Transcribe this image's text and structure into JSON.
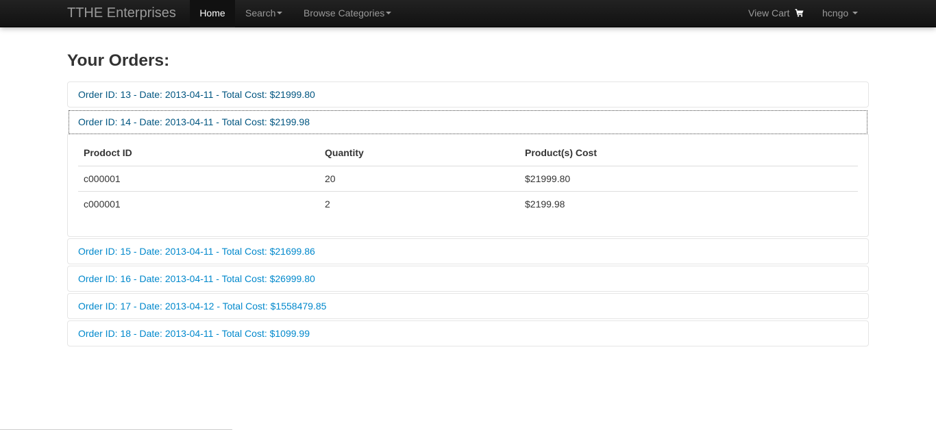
{
  "navbar": {
    "brand": "TTHE Enterprises",
    "home": "Home",
    "search": "Search",
    "browse_categories": "Browse Categories",
    "view_cart": "View Cart",
    "user": "hcngo"
  },
  "page": {
    "title": "Your Orders:"
  },
  "orders": [
    {
      "label": "Order ID: 13 - Date: 2013-04-11 - Total Cost: $21999.80"
    },
    {
      "label": "Order ID: 14 - Date: 2013-04-11 - Total Cost: $2199.98"
    },
    {
      "label": "Order ID: 15 - Date: 2013-04-11 - Total Cost: $21699.86"
    },
    {
      "label": "Order ID: 16 - Date: 2013-04-11 - Total Cost: $26999.80"
    },
    {
      "label": "Order ID: 17 - Date: 2013-04-12 - Total Cost: $1558479.85"
    },
    {
      "label": "Order ID: 18 - Date: 2013-04-11 - Total Cost: $1099.99"
    }
  ],
  "order_detail": {
    "columns": [
      "Prodoct ID",
      "Quantity",
      "Product(s) Cost"
    ],
    "rows": [
      [
        "c000001",
        "20",
        "$21999.80"
      ],
      [
        "c000001",
        "2",
        "$2199.98"
      ]
    ]
  }
}
